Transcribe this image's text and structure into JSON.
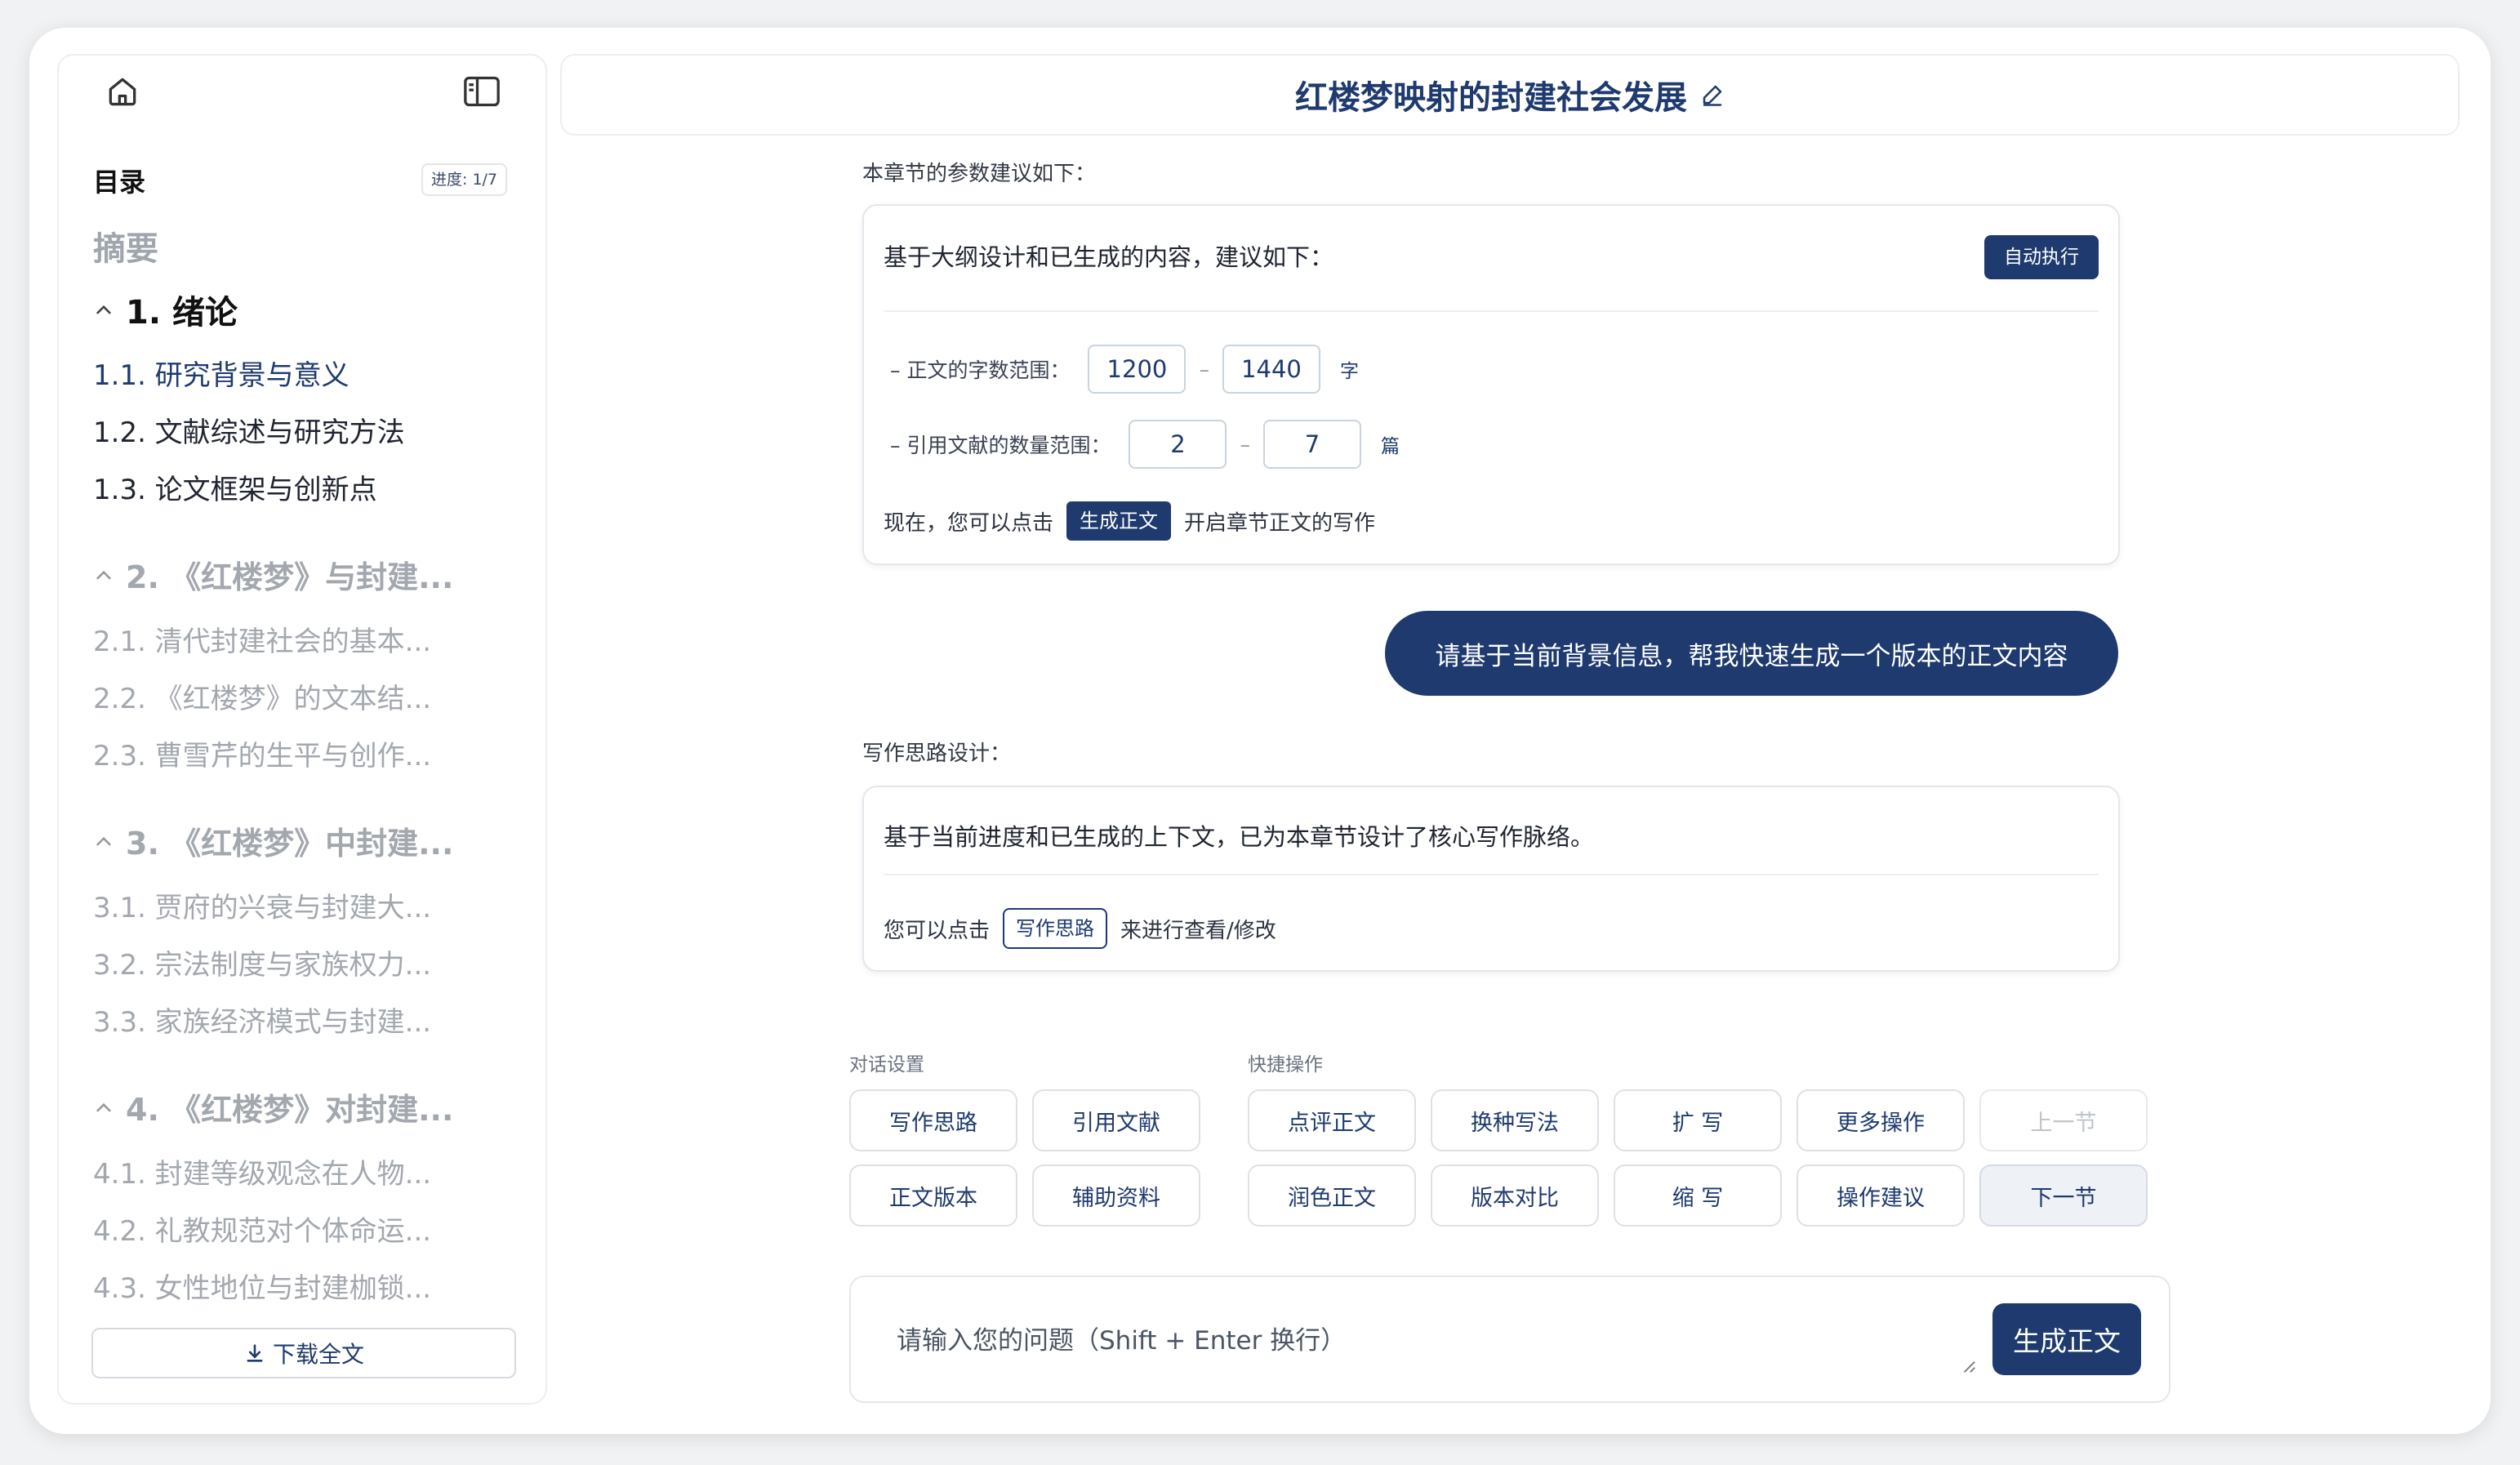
{
  "sidebar": {
    "toc_title": "目录",
    "progress": "进度: 1/7",
    "abstract": "摘要",
    "chapters": [
      {
        "title": "1. 绪论",
        "sections": [
          "1.1. 研究背景与意义",
          "1.2. 文献综述与研究方法",
          "1.3. 论文框架与创新点"
        ]
      },
      {
        "title": "2. 《红楼梦》与封建...",
        "sections": [
          "2.1. 清代封建社会的基本...",
          "2.2. 《红楼梦》的文本结...",
          "2.3. 曹雪芹的生平与创作..."
        ]
      },
      {
        "title": "3. 《红楼梦》中封建...",
        "sections": [
          "3.1. 贾府的兴衰与封建大...",
          "3.2. 宗法制度与家族权力...",
          "3.3. 家族经济模式与封建..."
        ]
      },
      {
        "title": "4. 《红楼梦》对封建...",
        "sections": [
          "4.1. 封建等级观念在人物...",
          "4.2. 礼教规范对个体命运...",
          "4.3. 女性地位与封建枷锁..."
        ]
      }
    ],
    "download": "下载全文"
  },
  "header": {
    "title": "红楼梦映射的封建社会发展"
  },
  "params": {
    "label": "本章节的参数建议如下：",
    "intro": "基于大纲设计和已生成的内容，建议如下：",
    "auto_exec": "自动执行",
    "word_range_label": "– 正文的字数范围：",
    "word_min": "1200",
    "word_max": "1440",
    "word_unit": "字",
    "ref_range_label": "– 引用文献的数量范围：",
    "ref_min": "2",
    "ref_max": "7",
    "ref_unit": "篇",
    "dash": "–",
    "prompt_before": "现在，您可以点击",
    "prompt_button": "生成正文",
    "prompt_after": "开启章节正文的写作"
  },
  "user_message": "请基于当前背景信息，帮我快速生成一个版本的正文内容",
  "thinking": {
    "label": "写作思路设计：",
    "text": "基于当前进度和已生成的上下文，已为本章节设计了核心写作脉络。",
    "prompt_before": "您可以点击",
    "prompt_button": "写作思路",
    "prompt_after": "来进行查看/修改"
  },
  "settings": {
    "label": "对话设置",
    "buttons": [
      "写作思路",
      "引用文献",
      "正文版本",
      "辅助资料"
    ]
  },
  "quick": {
    "label": "快捷操作",
    "row1": [
      "点评正文",
      "换种写法",
      "扩 写",
      "更多操作",
      "上一节"
    ],
    "row2": [
      "润色正文",
      "版本对比",
      "缩 写",
      "操作建议",
      "下一节"
    ]
  },
  "input": {
    "placeholder": "请输入您的问题（Shift + Enter 换行）",
    "send": "生成正文"
  }
}
